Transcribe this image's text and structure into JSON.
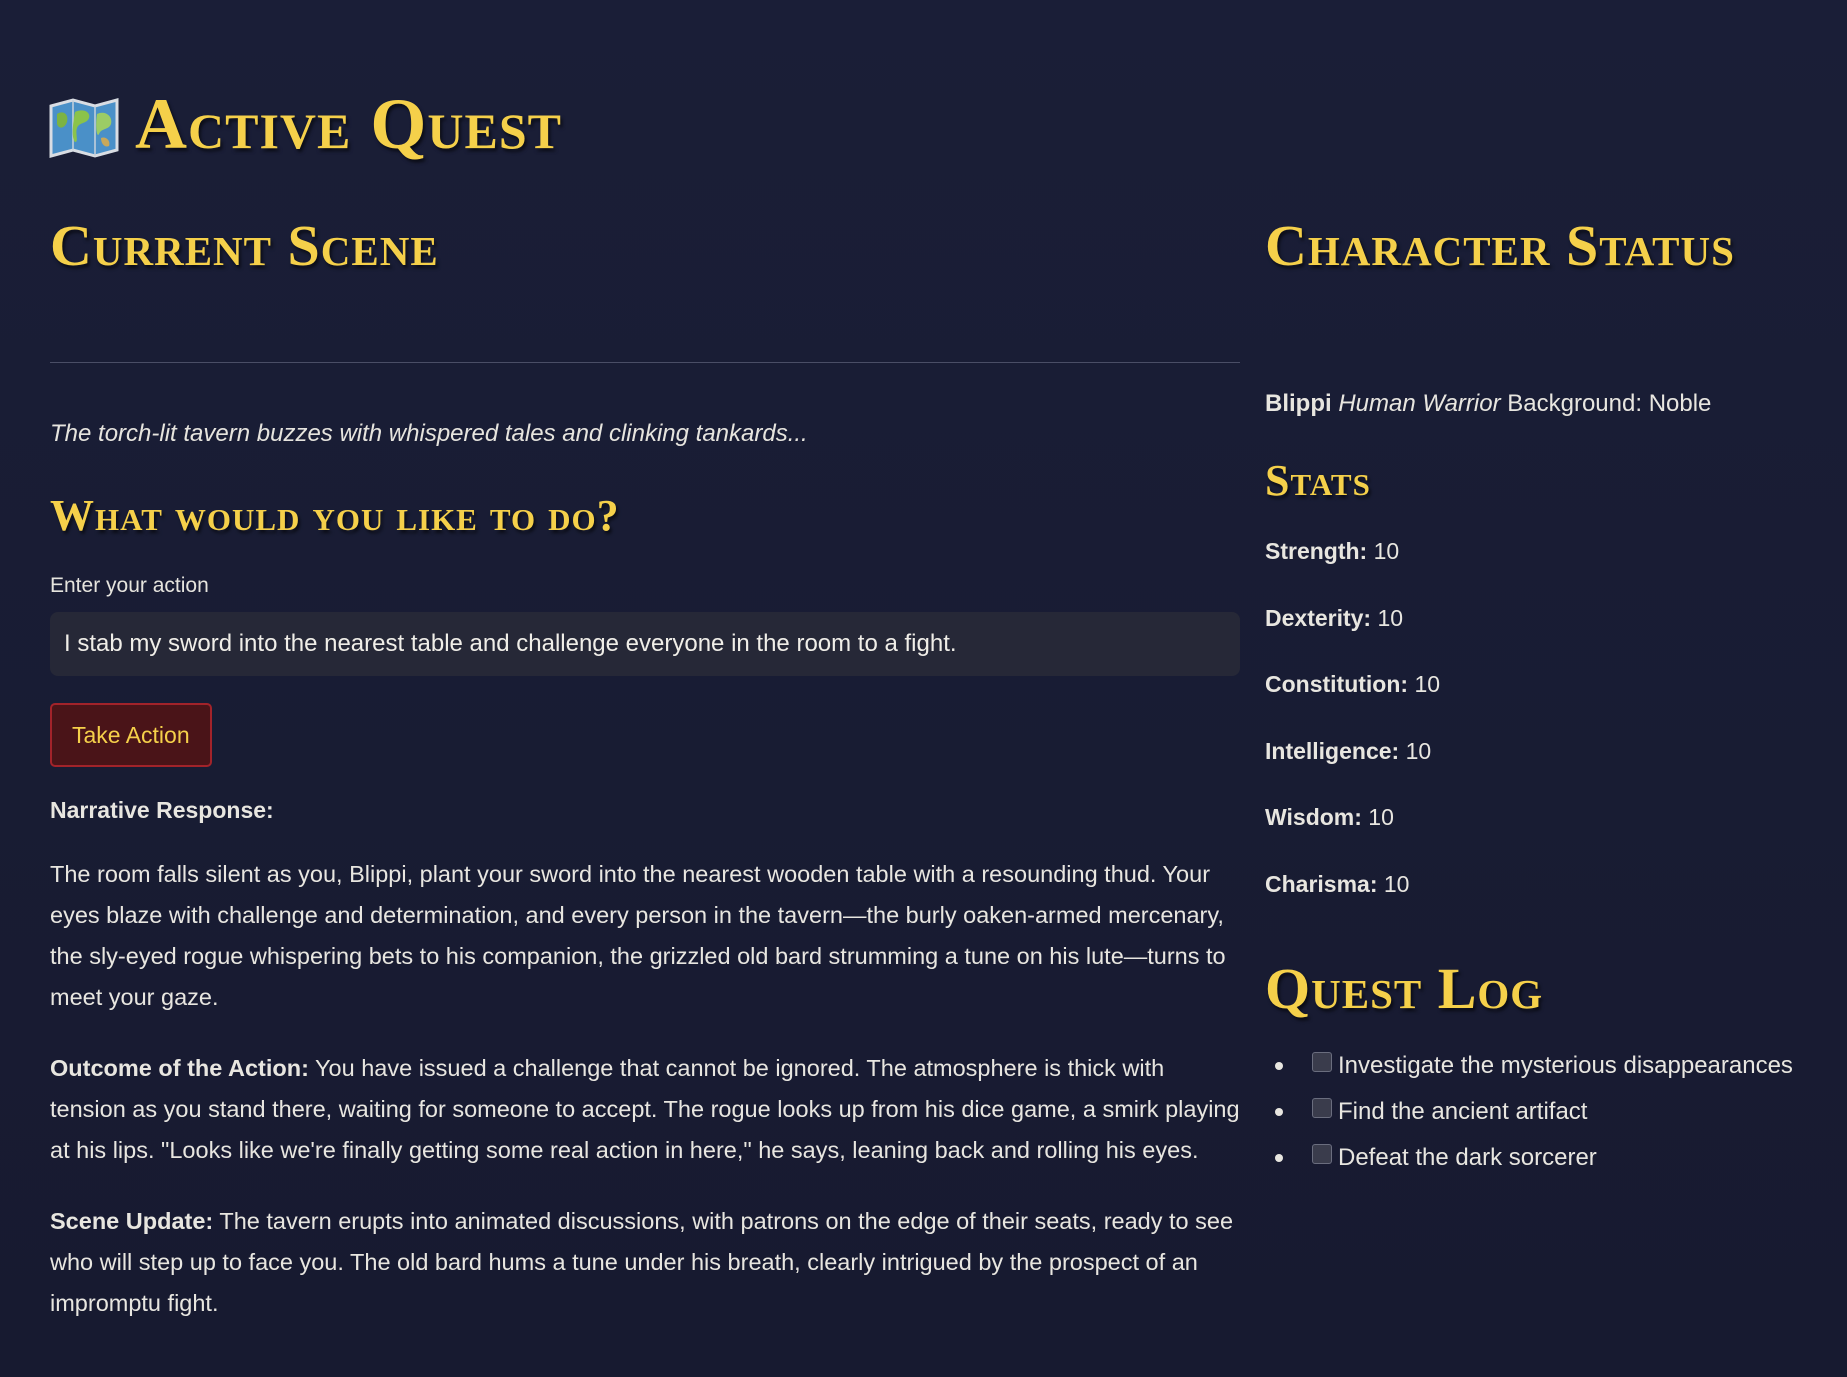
{
  "app": {
    "title": "Active Quest",
    "title_icon": "world-map-icon"
  },
  "scene": {
    "heading": "Current Scene",
    "description": "The torch-lit tavern buzzes with whispered tales and clinking tankards...",
    "prompt_heading": "What would you like to do?",
    "input_label": "Enter your action",
    "input_value": "I stab my sword into the nearest table and challenge everyone in the room to a fight.",
    "button_label": "Take Action",
    "narrative_heading": "Narrative Response:",
    "narrative_paragraph": "The room falls silent as you, Blippi, plant your sword into the nearest wooden table with a resounding thud. Your eyes blaze with challenge and determination, and every person in the tavern—the burly oaken-armed mercenary, the sly-eyed rogue whispering bets to his companion, the grizzled old bard strumming a tune on his lute—turns to meet your gaze.",
    "outcome_label": "Outcome of the Action:",
    "outcome_text": " You have issued a challenge that cannot be ignored. The atmosphere is thick with tension as you stand there, waiting for someone to accept. The rogue looks up from his dice game, a smirk playing at his lips. \"Looks like we're finally getting some real action in here,\" he says, leaning back and rolling his eyes.",
    "update_label": "Scene Update:",
    "update_text": " The tavern erupts into animated discussions, with patrons on the edge of their seats, ready to see who will step up to face you. The old bard hums a tune under his breath, clearly intrigued by the prospect of an impromptu fight."
  },
  "character": {
    "heading": "Character Status",
    "name": "Blippi",
    "race_class": "Human Warrior",
    "background": "Background: Noble",
    "stats_heading": "Stats",
    "stats": [
      {
        "label": "Strength:",
        "value": "10"
      },
      {
        "label": "Dexterity:",
        "value": "10"
      },
      {
        "label": "Constitution:",
        "value": "10"
      },
      {
        "label": "Intelligence:",
        "value": "10"
      },
      {
        "label": "Wisdom:",
        "value": "10"
      },
      {
        "label": "Charisma:",
        "value": "10"
      }
    ]
  },
  "quest_log": {
    "heading": "Quest Log",
    "items": [
      {
        "label": "Investigate the mysterious disappearances",
        "checked": false
      },
      {
        "label": "Find the ancient artifact",
        "checked": false
      },
      {
        "label": "Defeat the dark sorcerer",
        "checked": false
      }
    ]
  },
  "colors": {
    "background": "#181c33",
    "title_gold": "#f5d04a",
    "button_bg": "#4a1418",
    "button_border": "#a2232a",
    "input_bg": "#262837"
  }
}
